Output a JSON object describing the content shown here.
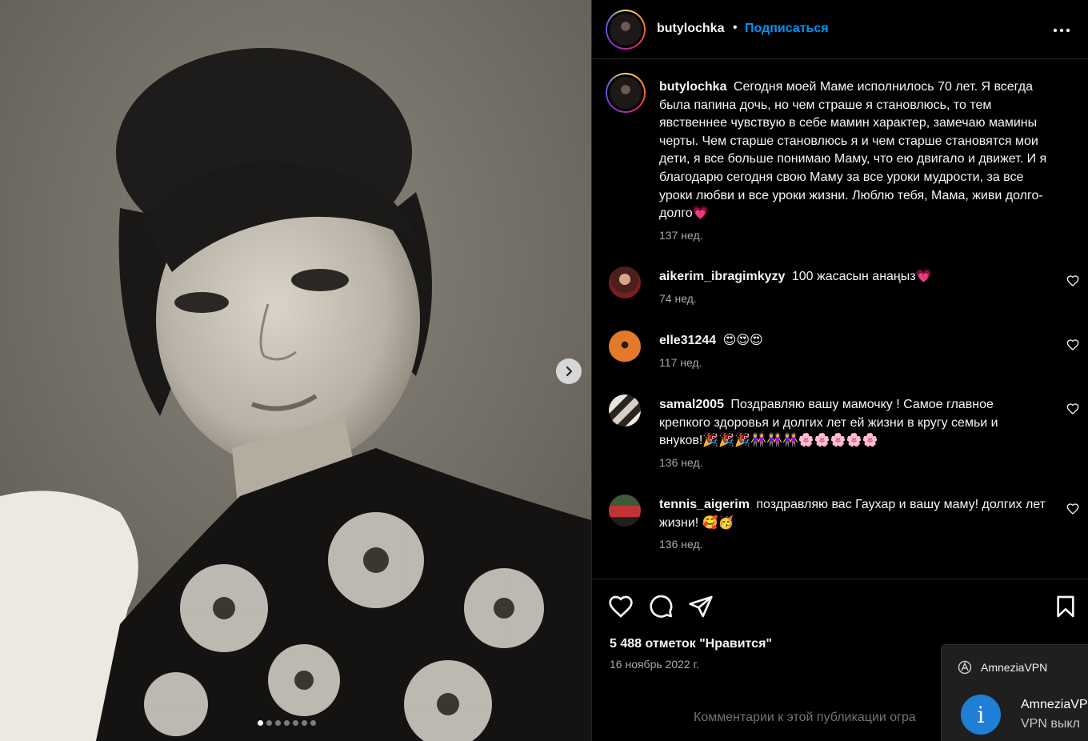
{
  "post": {
    "username": "butylochka",
    "separator": "•",
    "follow_label": "Подписаться",
    "more_icon": "more-horizontal-icon",
    "caption": "Сегодня моей Маме исполнилось 70 лет. Я всегда была папина дочь, но чем страше я становлюсь, то тем явственнее чувствую в себе мамин характер, замечаю мамины черты. Чем старше становлюсь я и чем старше становятся мои дети, я все больше понимаю Маму, что ею двигало и движет. И я благодарю сегодня свою Маму за все уроки мудрости, за все уроки любви и все уроки жизни. Люблю тебя, Мама, живи долго-долго💗",
    "caption_time": "137 нед.",
    "likes": "5 488 отметок \"Нравится\"",
    "date": "16 ноябрь 2022 г.",
    "comments_closed": "Комментарии к этой публикации огра",
    "carousel": {
      "slides": 7,
      "current": 1
    }
  },
  "comments": [
    {
      "username": "aikerim_ibragimkyzy",
      "text": "100 жасасын анаңыз💗",
      "time": "74 нед."
    },
    {
      "username": "elle31244",
      "text": "😍😍😍",
      "time": "117 нед."
    },
    {
      "username": "samal2005",
      "text": "Поздравляю вашу мамочку ! Самое главное крепкого здоровья и долгих лет ей жизни в кругу семьи и внуков!🎉🎉🎉👭👭👭🌸🌸🌸🌸🌸",
      "time": "136 нед."
    },
    {
      "username": "tennis_aigerim",
      "text": "поздравляю вас Гаухар и вашу маму! долгих лет жизни! 🥰🥳",
      "time": "136 нед."
    }
  ],
  "notification": {
    "app_name": "AmneziaVPN",
    "title": "AmneziaVP",
    "body": "VPN выкл",
    "icon": "info-icon"
  },
  "colors": {
    "link": "#0095f6",
    "background": "#000000",
    "muted": "#a8a8a8"
  }
}
